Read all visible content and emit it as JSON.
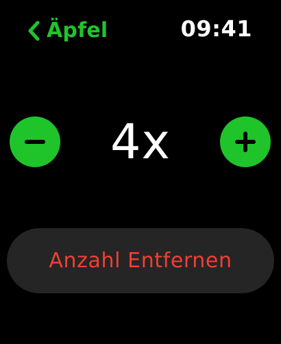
{
  "header": {
    "back_label": "Äpfel",
    "back_icon": "chevron-left-icon",
    "time": "09:41"
  },
  "stepper": {
    "quantity_text": "4x",
    "minus_icon": "minus-icon",
    "plus_icon": "plus-icon"
  },
  "actions": {
    "remove_label": "Anzahl Entfernen"
  },
  "colors": {
    "background": "#000000",
    "accent_green": "#1FC42A",
    "destructive_red": "#F23F35",
    "button_background": "#252525",
    "text_primary": "#FFFFFF"
  }
}
